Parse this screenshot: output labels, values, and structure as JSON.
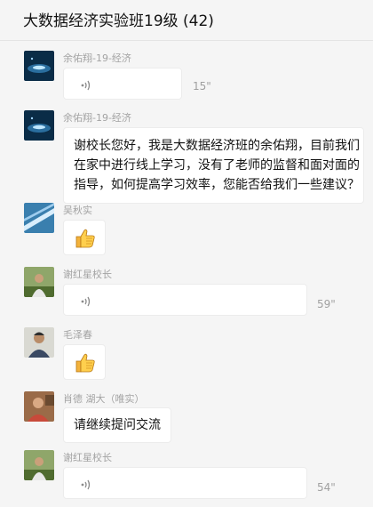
{
  "header": {
    "title": "大数据经济实验班19级 (42)"
  },
  "messages": [
    {
      "sender": "余佑翔-19-经济",
      "type": "voice",
      "duration": "15\""
    },
    {
      "sender": "余佑翔-19-经济",
      "type": "text",
      "lines": [
        "谢校长您好，我是大数据经济班的余佑翔，目前我们",
        "在家中进行线上学习，没有了老师的监督和面对面的",
        "指导，如何提高学习效率，您能否给我们一些建议？"
      ]
    },
    {
      "sender": "吴秋实",
      "type": "emoji",
      "emoji": "thumbs-up-emoji"
    },
    {
      "sender": "谢红星校长",
      "type": "voice",
      "duration": "59\""
    },
    {
      "sender": "毛泽春",
      "type": "emoji",
      "emoji": "thumbs-up-emoji"
    },
    {
      "sender": "肖德  湖大（唯实）",
      "type": "text",
      "lines": [
        "请继续提问交流"
      ]
    },
    {
      "sender": "谢红星校长",
      "type": "voice",
      "duration": "54\""
    }
  ],
  "icons": {
    "voice": "voice-wave-icon",
    "thumb": "thumbs-up-icon"
  }
}
